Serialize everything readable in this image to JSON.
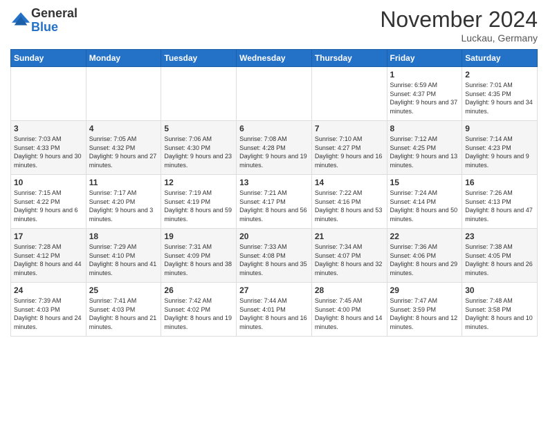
{
  "logo": {
    "general": "General",
    "blue": "Blue"
  },
  "header": {
    "month": "November 2024",
    "location": "Luckau, Germany"
  },
  "weekdays": [
    "Sunday",
    "Monday",
    "Tuesday",
    "Wednesday",
    "Thursday",
    "Friday",
    "Saturday"
  ],
  "weeks": [
    [
      {
        "day": "",
        "sunrise": "",
        "sunset": "",
        "daylight": ""
      },
      {
        "day": "",
        "sunrise": "",
        "sunset": "",
        "daylight": ""
      },
      {
        "day": "",
        "sunrise": "",
        "sunset": "",
        "daylight": ""
      },
      {
        "day": "",
        "sunrise": "",
        "sunset": "",
        "daylight": ""
      },
      {
        "day": "",
        "sunrise": "",
        "sunset": "",
        "daylight": ""
      },
      {
        "day": "1",
        "sunrise": "Sunrise: 6:59 AM",
        "sunset": "Sunset: 4:37 PM",
        "daylight": "Daylight: 9 hours and 37 minutes."
      },
      {
        "day": "2",
        "sunrise": "Sunrise: 7:01 AM",
        "sunset": "Sunset: 4:35 PM",
        "daylight": "Daylight: 9 hours and 34 minutes."
      }
    ],
    [
      {
        "day": "3",
        "sunrise": "Sunrise: 7:03 AM",
        "sunset": "Sunset: 4:33 PM",
        "daylight": "Daylight: 9 hours and 30 minutes."
      },
      {
        "day": "4",
        "sunrise": "Sunrise: 7:05 AM",
        "sunset": "Sunset: 4:32 PM",
        "daylight": "Daylight: 9 hours and 27 minutes."
      },
      {
        "day": "5",
        "sunrise": "Sunrise: 7:06 AM",
        "sunset": "Sunset: 4:30 PM",
        "daylight": "Daylight: 9 hours and 23 minutes."
      },
      {
        "day": "6",
        "sunrise": "Sunrise: 7:08 AM",
        "sunset": "Sunset: 4:28 PM",
        "daylight": "Daylight: 9 hours and 19 minutes."
      },
      {
        "day": "7",
        "sunrise": "Sunrise: 7:10 AM",
        "sunset": "Sunset: 4:27 PM",
        "daylight": "Daylight: 9 hours and 16 minutes."
      },
      {
        "day": "8",
        "sunrise": "Sunrise: 7:12 AM",
        "sunset": "Sunset: 4:25 PM",
        "daylight": "Daylight: 9 hours and 13 minutes."
      },
      {
        "day": "9",
        "sunrise": "Sunrise: 7:14 AM",
        "sunset": "Sunset: 4:23 PM",
        "daylight": "Daylight: 9 hours and 9 minutes."
      }
    ],
    [
      {
        "day": "10",
        "sunrise": "Sunrise: 7:15 AM",
        "sunset": "Sunset: 4:22 PM",
        "daylight": "Daylight: 9 hours and 6 minutes."
      },
      {
        "day": "11",
        "sunrise": "Sunrise: 7:17 AM",
        "sunset": "Sunset: 4:20 PM",
        "daylight": "Daylight: 9 hours and 3 minutes."
      },
      {
        "day": "12",
        "sunrise": "Sunrise: 7:19 AM",
        "sunset": "Sunset: 4:19 PM",
        "daylight": "Daylight: 8 hours and 59 minutes."
      },
      {
        "day": "13",
        "sunrise": "Sunrise: 7:21 AM",
        "sunset": "Sunset: 4:17 PM",
        "daylight": "Daylight: 8 hours and 56 minutes."
      },
      {
        "day": "14",
        "sunrise": "Sunrise: 7:22 AM",
        "sunset": "Sunset: 4:16 PM",
        "daylight": "Daylight: 8 hours and 53 minutes."
      },
      {
        "day": "15",
        "sunrise": "Sunrise: 7:24 AM",
        "sunset": "Sunset: 4:14 PM",
        "daylight": "Daylight: 8 hours and 50 minutes."
      },
      {
        "day": "16",
        "sunrise": "Sunrise: 7:26 AM",
        "sunset": "Sunset: 4:13 PM",
        "daylight": "Daylight: 8 hours and 47 minutes."
      }
    ],
    [
      {
        "day": "17",
        "sunrise": "Sunrise: 7:28 AM",
        "sunset": "Sunset: 4:12 PM",
        "daylight": "Daylight: 8 hours and 44 minutes."
      },
      {
        "day": "18",
        "sunrise": "Sunrise: 7:29 AM",
        "sunset": "Sunset: 4:10 PM",
        "daylight": "Daylight: 8 hours and 41 minutes."
      },
      {
        "day": "19",
        "sunrise": "Sunrise: 7:31 AM",
        "sunset": "Sunset: 4:09 PM",
        "daylight": "Daylight: 8 hours and 38 minutes."
      },
      {
        "day": "20",
        "sunrise": "Sunrise: 7:33 AM",
        "sunset": "Sunset: 4:08 PM",
        "daylight": "Daylight: 8 hours and 35 minutes."
      },
      {
        "day": "21",
        "sunrise": "Sunrise: 7:34 AM",
        "sunset": "Sunset: 4:07 PM",
        "daylight": "Daylight: 8 hours and 32 minutes."
      },
      {
        "day": "22",
        "sunrise": "Sunrise: 7:36 AM",
        "sunset": "Sunset: 4:06 PM",
        "daylight": "Daylight: 8 hours and 29 minutes."
      },
      {
        "day": "23",
        "sunrise": "Sunrise: 7:38 AM",
        "sunset": "Sunset: 4:05 PM",
        "daylight": "Daylight: 8 hours and 26 minutes."
      }
    ],
    [
      {
        "day": "24",
        "sunrise": "Sunrise: 7:39 AM",
        "sunset": "Sunset: 4:03 PM",
        "daylight": "Daylight: 8 hours and 24 minutes."
      },
      {
        "day": "25",
        "sunrise": "Sunrise: 7:41 AM",
        "sunset": "Sunset: 4:03 PM",
        "daylight": "Daylight: 8 hours and 21 minutes."
      },
      {
        "day": "26",
        "sunrise": "Sunrise: 7:42 AM",
        "sunset": "Sunset: 4:02 PM",
        "daylight": "Daylight: 8 hours and 19 minutes."
      },
      {
        "day": "27",
        "sunrise": "Sunrise: 7:44 AM",
        "sunset": "Sunset: 4:01 PM",
        "daylight": "Daylight: 8 hours and 16 minutes."
      },
      {
        "day": "28",
        "sunrise": "Sunrise: 7:45 AM",
        "sunset": "Sunset: 4:00 PM",
        "daylight": "Daylight: 8 hours and 14 minutes."
      },
      {
        "day": "29",
        "sunrise": "Sunrise: 7:47 AM",
        "sunset": "Sunset: 3:59 PM",
        "daylight": "Daylight: 8 hours and 12 minutes."
      },
      {
        "day": "30",
        "sunrise": "Sunrise: 7:48 AM",
        "sunset": "Sunset: 3:58 PM",
        "daylight": "Daylight: 8 hours and 10 minutes."
      }
    ]
  ]
}
